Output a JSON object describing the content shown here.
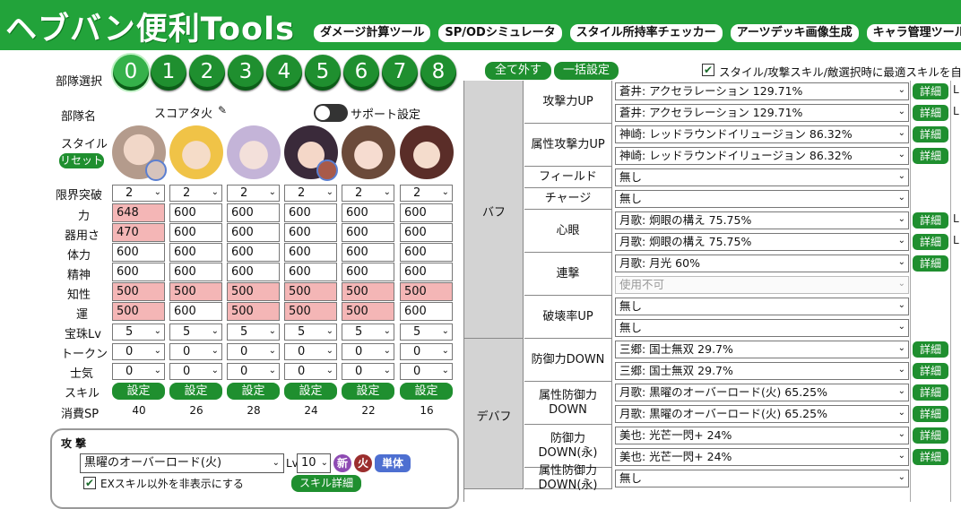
{
  "app": {
    "title": "ヘブバン便利Tools"
  },
  "nav": [
    "ダメージ計算ツール",
    "SP/ODシミュレータ",
    "スタイル所持率チェッカー",
    "アーツデッキ画像生成",
    "キャラ管理ツール"
  ],
  "party": {
    "select_label": "部隊選択",
    "numbers": [
      "0",
      "1",
      "2",
      "3",
      "4",
      "5",
      "6",
      "7",
      "8"
    ],
    "selected": "0",
    "name_label": "部隊名",
    "name": "スコアタ火",
    "support_label": "サポート設定"
  },
  "style": {
    "label": "スタイル",
    "reset": "リセット"
  },
  "stats": {
    "labels": [
      "限界突破",
      "力",
      "器用さ",
      "体力",
      "精神",
      "知性",
      "運",
      "宝珠Lv",
      "トークン",
      "士気",
      "スキル",
      "消費SP"
    ],
    "limit": [
      "2",
      "2",
      "2",
      "2",
      "2",
      "2"
    ],
    "power": [
      "648",
      "600",
      "600",
      "600",
      "600",
      "600"
    ],
    "dex": [
      "470",
      "600",
      "600",
      "600",
      "600",
      "600"
    ],
    "hp": [
      "600",
      "600",
      "600",
      "600",
      "600",
      "600"
    ],
    "spirit": [
      "600",
      "600",
      "600",
      "600",
      "600",
      "600"
    ],
    "int": [
      "500",
      "500",
      "500",
      "500",
      "500",
      "500"
    ],
    "luck": [
      "500",
      "600",
      "500",
      "500",
      "500",
      "600"
    ],
    "orb": [
      "5",
      "5",
      "5",
      "5",
      "5",
      "5"
    ],
    "token": [
      "0",
      "0",
      "0",
      "0",
      "0",
      "0"
    ],
    "morale": [
      "0",
      "0",
      "0",
      "0",
      "0",
      "0"
    ],
    "skill_btn": "設定",
    "sp": [
      "40",
      "26",
      "28",
      "24",
      "22",
      "16"
    ]
  },
  "attack": {
    "title": "攻 撃",
    "skill": "黒曜のオーバーロード(火)",
    "lv_label": "Lv",
    "lv": "10",
    "chips": [
      "新",
      "火",
      "単体"
    ],
    "ex_label": "EXスキル以外を非表示にする",
    "detail": "スキル詳細"
  },
  "buff_panel": {
    "unselect_all": "全て外す",
    "set_all": "一括設定",
    "auto_label": "スタイル/攻撃スキル/敵選択時に最適スキルを自動",
    "detail": "詳細",
    "cats": [
      "バフ",
      "デバフ"
    ],
    "rows": [
      {
        "label": "攻撃力UP",
        "values": [
          "蒼井: アクセラレーション 129.71%",
          "蒼井: アクセラレーション 129.71%"
        ]
      },
      {
        "label": "属性攻撃力UP",
        "values": [
          "神崎: レッドラウンドイリュージョン 86.32%",
          "神崎: レッドラウンドイリュージョン 86.32%"
        ]
      },
      {
        "label": "フィールド",
        "values": [
          "無し"
        ]
      },
      {
        "label": "チャージ",
        "values": [
          "無し"
        ]
      },
      {
        "label": "心眼",
        "values": [
          "月歌: 炯眼の構え 75.75%",
          "月歌: 炯眼の構え 75.75%"
        ]
      },
      {
        "label": "連撃",
        "values": [
          "月歌: 月光 60%",
          "使用不可"
        ]
      },
      {
        "label": "破壊率UP",
        "values": [
          "無し",
          "無し"
        ]
      },
      {
        "label": "防御力DOWN",
        "values": [
          "三郷: 国士無双 29.7%",
          "三郷: 国士無双 29.7%"
        ]
      },
      {
        "label": "属性防御力DOWN",
        "values": [
          "月歌: 黒曜のオーバーロード(火) 65.25%",
          "月歌: 黒曜のオーバーロード(火) 65.25%"
        ]
      },
      {
        "label": "防御力DOWN(永)",
        "values": [
          "美也: 光芒一閃+ 24%",
          "美也: 光芒一閃+ 24%"
        ]
      },
      {
        "label": "属性防御力DOWN(永)",
        "values": [
          "無し"
        ]
      }
    ],
    "cut_letter": "L"
  },
  "colors": {
    "green": "#22a33a",
    "pink": "#f4b6b6",
    "category": "#d3d3d3"
  }
}
